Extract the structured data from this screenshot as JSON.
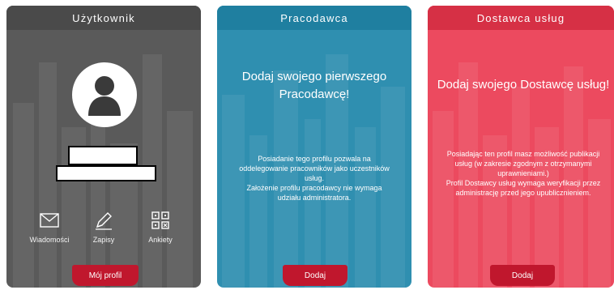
{
  "user_card": {
    "title": "Użytkownik",
    "links": {
      "messages": "Wiadomości",
      "entries": "Zapisy",
      "surveys": "Ankiety"
    },
    "profile_button": "Mój profil",
    "icons": [
      "user-avatar-icon",
      "envelope-icon",
      "pencil-icon",
      "qr-grid-icon"
    ]
  },
  "employer_card": {
    "title": "Pracodawca",
    "headline_line1": "Dodaj swojego pierwszego",
    "headline_line2": "Pracodawcę!",
    "desc_l1": "Posiadanie tego profilu pozwala na",
    "desc_l2": "oddelegowanie pracowników jako uczestników",
    "desc_l3": "usług.",
    "desc_l4": "Założenie profilu pracodawcy nie wymaga",
    "desc_l5": "udziału administratora.",
    "add_button": "Dodaj"
  },
  "provider_card": {
    "title": "Dostawca usług",
    "headline": "Dodaj swojego Dostawcę usług!",
    "desc_l1": "Posiadając ten profil masz możliwość publikacji",
    "desc_l2": "usług (w zakresie zgodnym z otrzymanymi",
    "desc_l3": "uprawnieniami.)",
    "desc_l4": "Profil Dostawcy usług wymaga weryfikacji przez",
    "desc_l5": "administrację przed jego upublicznieniem.",
    "add_button": "Dodaj"
  },
  "colors": {
    "user_card": "#5a5a5a",
    "employer_card": "#2f8fb0",
    "provider_card": "#ec4a5f",
    "button_red": "#c0172d"
  }
}
